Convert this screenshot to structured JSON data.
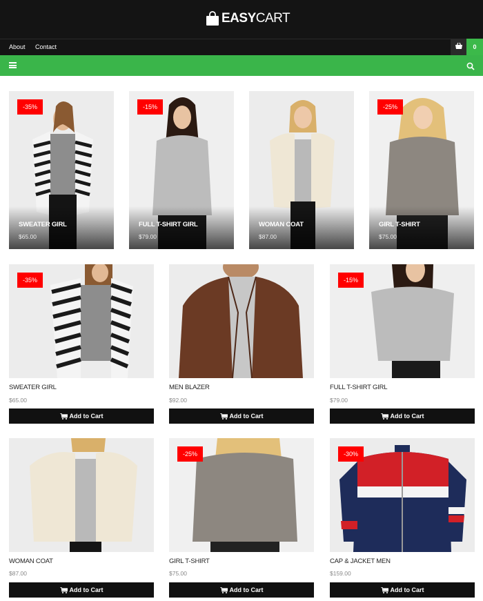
{
  "brand": {
    "bold": "EASY",
    "thin": "CART"
  },
  "nav": {
    "about": "About",
    "contact": "Contact"
  },
  "cart": {
    "count": "0"
  },
  "icons": {
    "logo": "shopping-bag-icon",
    "cart": "basket-icon",
    "menu": "hamburger-icon",
    "search": "search-icon"
  },
  "colors": {
    "header": "#141414",
    "accent": "#3ab54a",
    "badge": "#ff0000",
    "button": "#111111"
  },
  "featured": [
    {
      "name": "SWEATER GIRL",
      "price": "$65.00",
      "discount": "-35%"
    },
    {
      "name": "FULL T-SHIRT GIRL",
      "price": "$79.00",
      "discount": "-15%"
    },
    {
      "name": "WOMAN COAT",
      "price": "$87.00",
      "discount": ""
    },
    {
      "name": "GIRL T-SHIRT",
      "price": "$75.00",
      "discount": "-25%"
    }
  ],
  "products": [
    {
      "name": "SWEATER GIRL",
      "price": "$65.00",
      "discount": "-35%",
      "button": "Add to Cart"
    },
    {
      "name": "MEN BLAZER",
      "price": "$92.00",
      "discount": "",
      "button": "Add to Cart"
    },
    {
      "name": "FULL T-SHIRT GIRL",
      "price": "$79.00",
      "discount": "-15%",
      "button": "Add to Cart"
    },
    {
      "name": "WOMAN COAT",
      "price": "$87.00",
      "discount": "",
      "button": "Add to Cart"
    },
    {
      "name": "GIRL T-SHIRT",
      "price": "$75.00",
      "discount": "-25%",
      "button": "Add to Cart"
    },
    {
      "name": "CAP & JACKET MEN",
      "price": "$159.00",
      "discount": "-30%",
      "button": "Add to Cart"
    }
  ]
}
